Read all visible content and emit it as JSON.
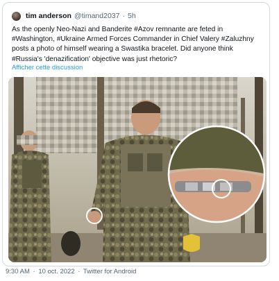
{
  "tweet": {
    "author_name": "tim anderson",
    "author_handle": "@timand2037",
    "separator": "·",
    "age": "5h",
    "text": "As the openly Neo-Nazi and Banderite #Azov remnante are feted in #Washington, #Ukraine Armed Forces Commander in Chief Valery #Zaluzhny posts a photo of himself wearing a Swastika bracelet. Did anyone think #Russia's 'denazification' objective was just rhetoric?",
    "translate_link": "Afficher cette discussion",
    "media_icon": "photo-image",
    "footer_time": "9:30 AM",
    "footer_separator": "·",
    "footer_date": "10 oct. 2022",
    "footer_source": "Twitter for Android"
  },
  "colors": {
    "link": "#1d9bf0",
    "secondary_text": "#536471",
    "border": "#cfd9de"
  }
}
